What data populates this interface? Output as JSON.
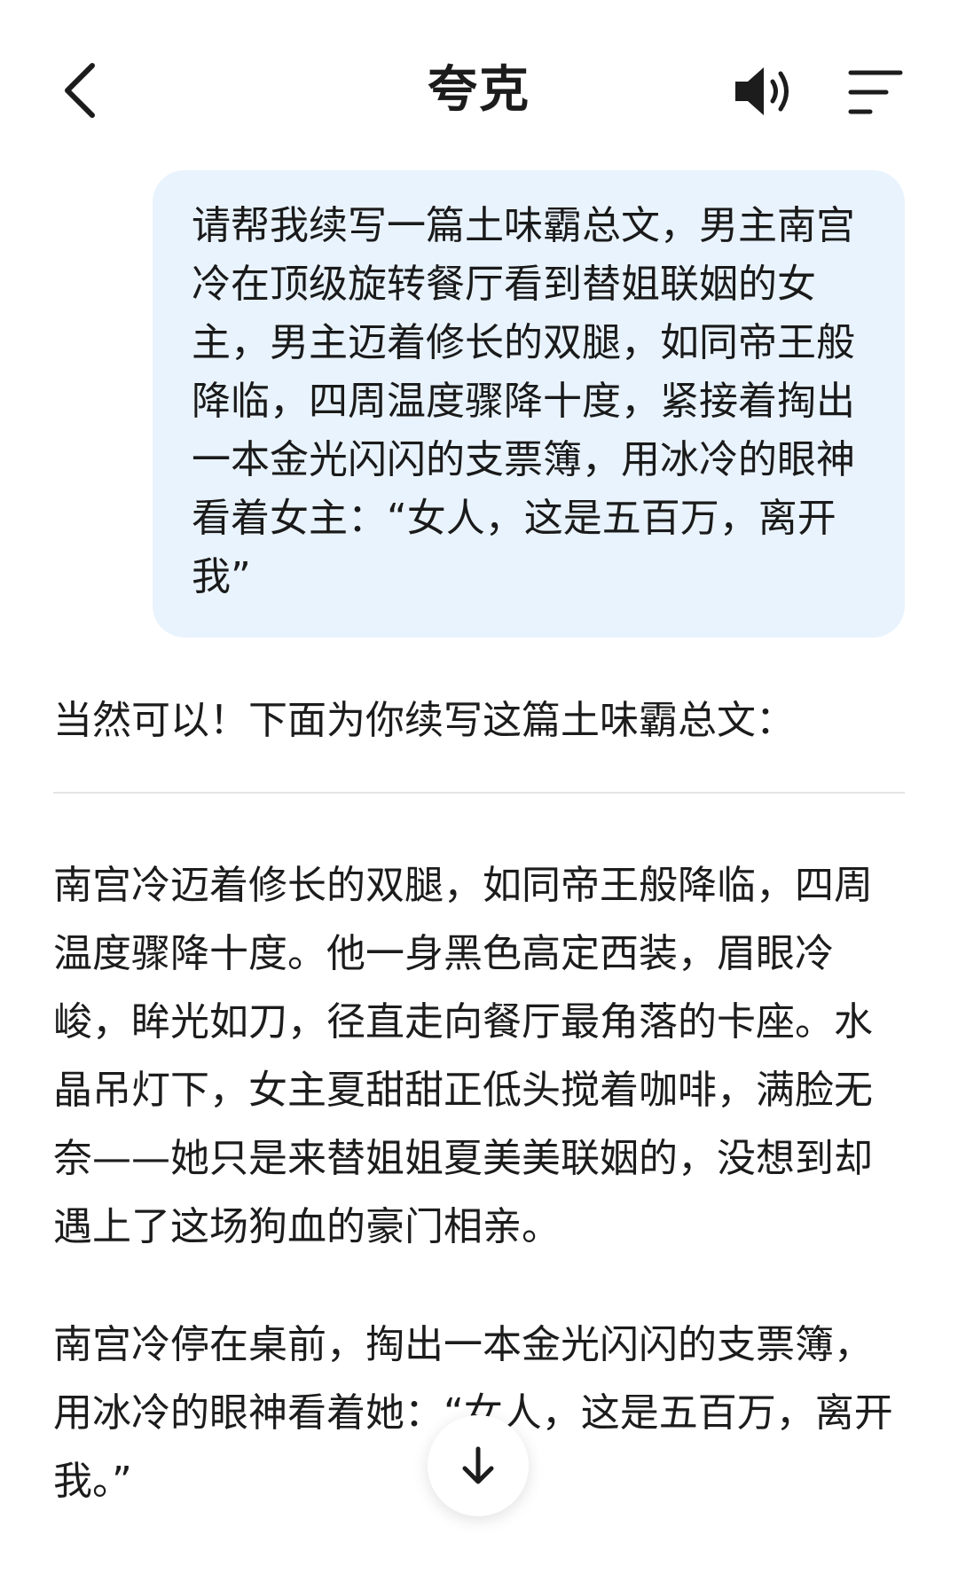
{
  "header": {
    "title": "夸克",
    "back_icon": "chevron-left-icon",
    "speaker_icon": "speaker-icon",
    "menu_icon": "menu-lines-icon"
  },
  "conversation": {
    "user_message": "请帮我续写一篇土味霸总文，男主南宫冷在顶级旋转餐厅看到替姐联姻的女主，男主迈着修长的双腿，如同帝王般降临，四周温度骤降十度，紧接着掏出一本金光闪闪的支票簿，用冰冷的眼神看着女主：“女人，这是五百万，离开我”",
    "reply_intro": "当然可以！下面为你续写这篇土味霸总文：",
    "reply_paragraphs": [
      "南宫冷迈着修长的双腿，如同帝王般降临，四周温度骤降十度。他一身黑色高定西装，眉眼冷峻，眸光如刀，径直走向餐厅最角落的卡座。水晶吊灯下，女主夏甜甜正低头搅着咖啡，满脸无奈——她只是来替姐姐夏美美联姻的，没想到却遇上了这场狗血的豪门相亲。",
      "南宫冷停在桌前，掏出一本金光闪闪的支票簿，用冰冷的眼神看着她：“女人，这是五百万，离开我。”"
    ]
  },
  "scroll_button": {
    "icon": "arrow-down-icon"
  },
  "colors": {
    "bubble_bg": "#e9f3fd",
    "text": "#1c1c1c",
    "divider": "#e4e4e4"
  }
}
